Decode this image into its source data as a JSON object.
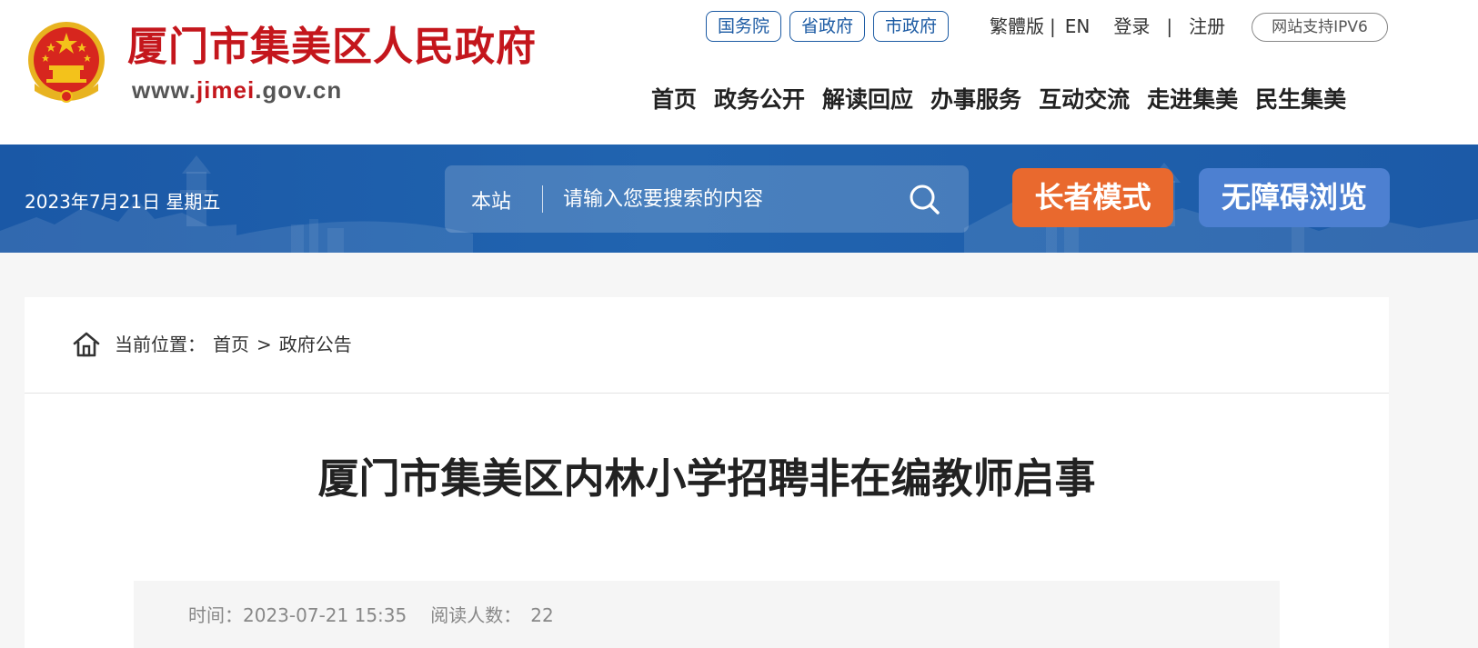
{
  "header": {
    "site_name": "厦门市集美区人民政府",
    "url_prefix": "www.",
    "url_highlight": "jimei",
    "url_suffix": ".gov.cn",
    "pills": [
      "国务院",
      "省政府",
      "市政府"
    ],
    "links": {
      "traditional": "繁體版",
      "sep": "|",
      "english": "EN",
      "login": "登录",
      "register": "注册"
    },
    "ipv6_badge": "网站支持IPV6",
    "nav": [
      "首页",
      "政务公开",
      "解读回应",
      "办事服务",
      "互动交流",
      "走进集美",
      "民生集美"
    ]
  },
  "banner": {
    "date": "2023年7月21日 星期五",
    "search": {
      "scope": "本站",
      "placeholder": "请输入您要搜索的内容"
    },
    "elder_mode": "长者模式",
    "accessible": "无障碍浏览"
  },
  "breadcrumb": {
    "label": "当前位置：",
    "home": "首页",
    "separator": ">",
    "current": "政府公告"
  },
  "article": {
    "title": "厦门市集美区内林小学招聘非在编教师启事",
    "time_label": "时间：",
    "time_value": "2023-07-21 15:35",
    "views_label": "阅读人数：",
    "views_value": "22"
  },
  "colors": {
    "brand_red": "#c4161c",
    "nav_blue": "#1b5aa3",
    "banner_blue": "#1f5fad",
    "elder_orange": "#e9692e",
    "access_blue": "#4d80d1"
  },
  "icons": [
    "national-emblem-icon",
    "search-icon",
    "home-icon"
  ]
}
